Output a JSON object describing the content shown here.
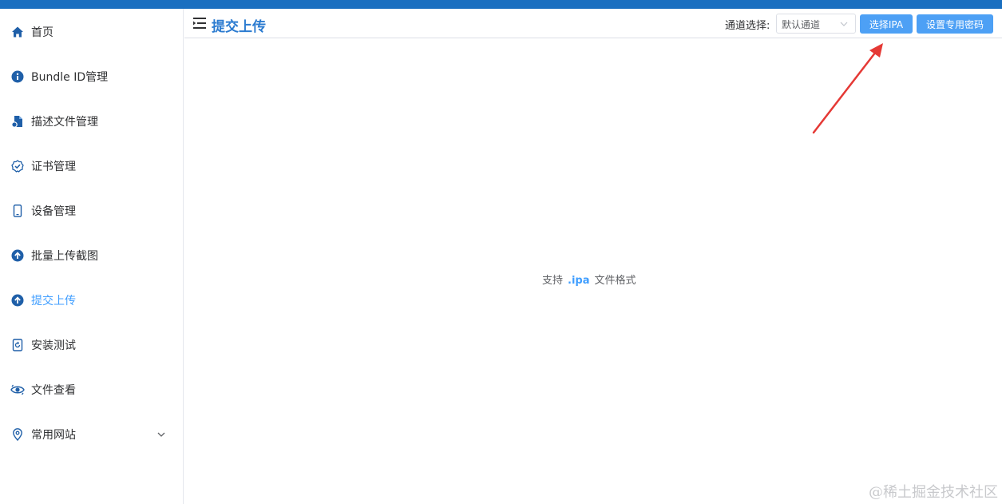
{
  "sidebar": {
    "items": [
      {
        "label": "首页",
        "icon": "home-icon"
      },
      {
        "label": "Bundle ID管理",
        "icon": "info-icon"
      },
      {
        "label": "描述文件管理",
        "icon": "file-settings-icon"
      },
      {
        "label": "证书管理",
        "icon": "certificate-check-icon"
      },
      {
        "label": "设备管理",
        "icon": "phone-icon"
      },
      {
        "label": "批量上传截图",
        "icon": "upload-circle-icon"
      },
      {
        "label": "提交上传",
        "icon": "upload-circle-icon",
        "active": true
      },
      {
        "label": "安装测试",
        "icon": "install-app-icon"
      },
      {
        "label": "文件查看",
        "icon": "eye-refresh-icon"
      },
      {
        "label": "常用网站",
        "icon": "location-pin-icon",
        "expandable": true
      }
    ]
  },
  "header": {
    "title": "提交上传",
    "channel_label": "通道选择:",
    "channel_value": "默认通道",
    "select_ipa_label": "选择IPA",
    "set_password_label": "设置专用密码"
  },
  "main": {
    "hint_prefix": "支持",
    "hint_ext": ".ipa",
    "hint_suffix": "文件格式"
  },
  "watermark": "@稀土掘金技术社区",
  "colors": {
    "accent": "#409eff",
    "button": "#4da0f5",
    "top_strip": "#1a6fc0",
    "title": "#2b7bd0",
    "annotation_arrow": "#e53935"
  }
}
